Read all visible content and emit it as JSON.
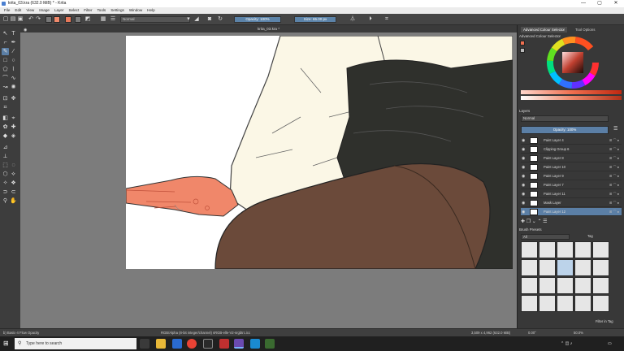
{
  "window": {
    "title": "krita_03.kra (632.0 MiB) * - Krita",
    "controls": {
      "minimize": "—",
      "maximize": "▢",
      "close": "✕"
    }
  },
  "menu": [
    "File",
    "Edit",
    "View",
    "Image",
    "Layer",
    "Select",
    "Filter",
    "Tools",
    "Settings",
    "Window",
    "Help"
  ],
  "toolbar": {
    "blend_mode": "Normal",
    "opacity_label": "Opacity: 100%",
    "size_label": "Size: 65.00 px"
  },
  "document_tab": "krita_03.kra *",
  "right_panel": {
    "tabs": [
      "Advanced Colour Selector",
      "Tool Options"
    ],
    "colour_header": "Advanced Colour Selector",
    "layers_header": "Layers",
    "layers_blend": "Normal",
    "layers_opacity": "Opacity: 100%",
    "layers": [
      {
        "name": "Paint Layer 4",
        "selected": false
      },
      {
        "name": "Clipping Group 6",
        "selected": false
      },
      {
        "name": "Paint Layer 8",
        "selected": false
      },
      {
        "name": "Paint Layer 10",
        "selected": false
      },
      {
        "name": "Paint Layer 9",
        "selected": false
      },
      {
        "name": "Paint Layer 7",
        "selected": false
      },
      {
        "name": "Paint Layer 11",
        "selected": false
      },
      {
        "name": "Mask Layer",
        "selected": false
      },
      {
        "name": "Paint Layer 12",
        "selected": true
      }
    ],
    "brush_header": "Brush Presets",
    "brush_filter": "All",
    "brush_tag": "Tag",
    "filter_in_tag": "Filter in Tag"
  },
  "status": {
    "brush": "b) Basic-4 Flow Opacity",
    "color_profile": "RGB/Alpha (8-bit integer/channel)  sRGB-elle-V2-srgbtrc.icc",
    "dimensions": "3,509 x 4,962 (632.0 MiB)",
    "rotation": "0.00°",
    "zoom": "50.0%"
  },
  "taskbar": {
    "search_placeholder": "Type here to search"
  },
  "colors": {
    "accent": "#5b7fa6",
    "skin": "#f0876a",
    "shirt": "#fbf7e6",
    "skirt": "#2f302c",
    "legs": "#6b4a3a"
  }
}
